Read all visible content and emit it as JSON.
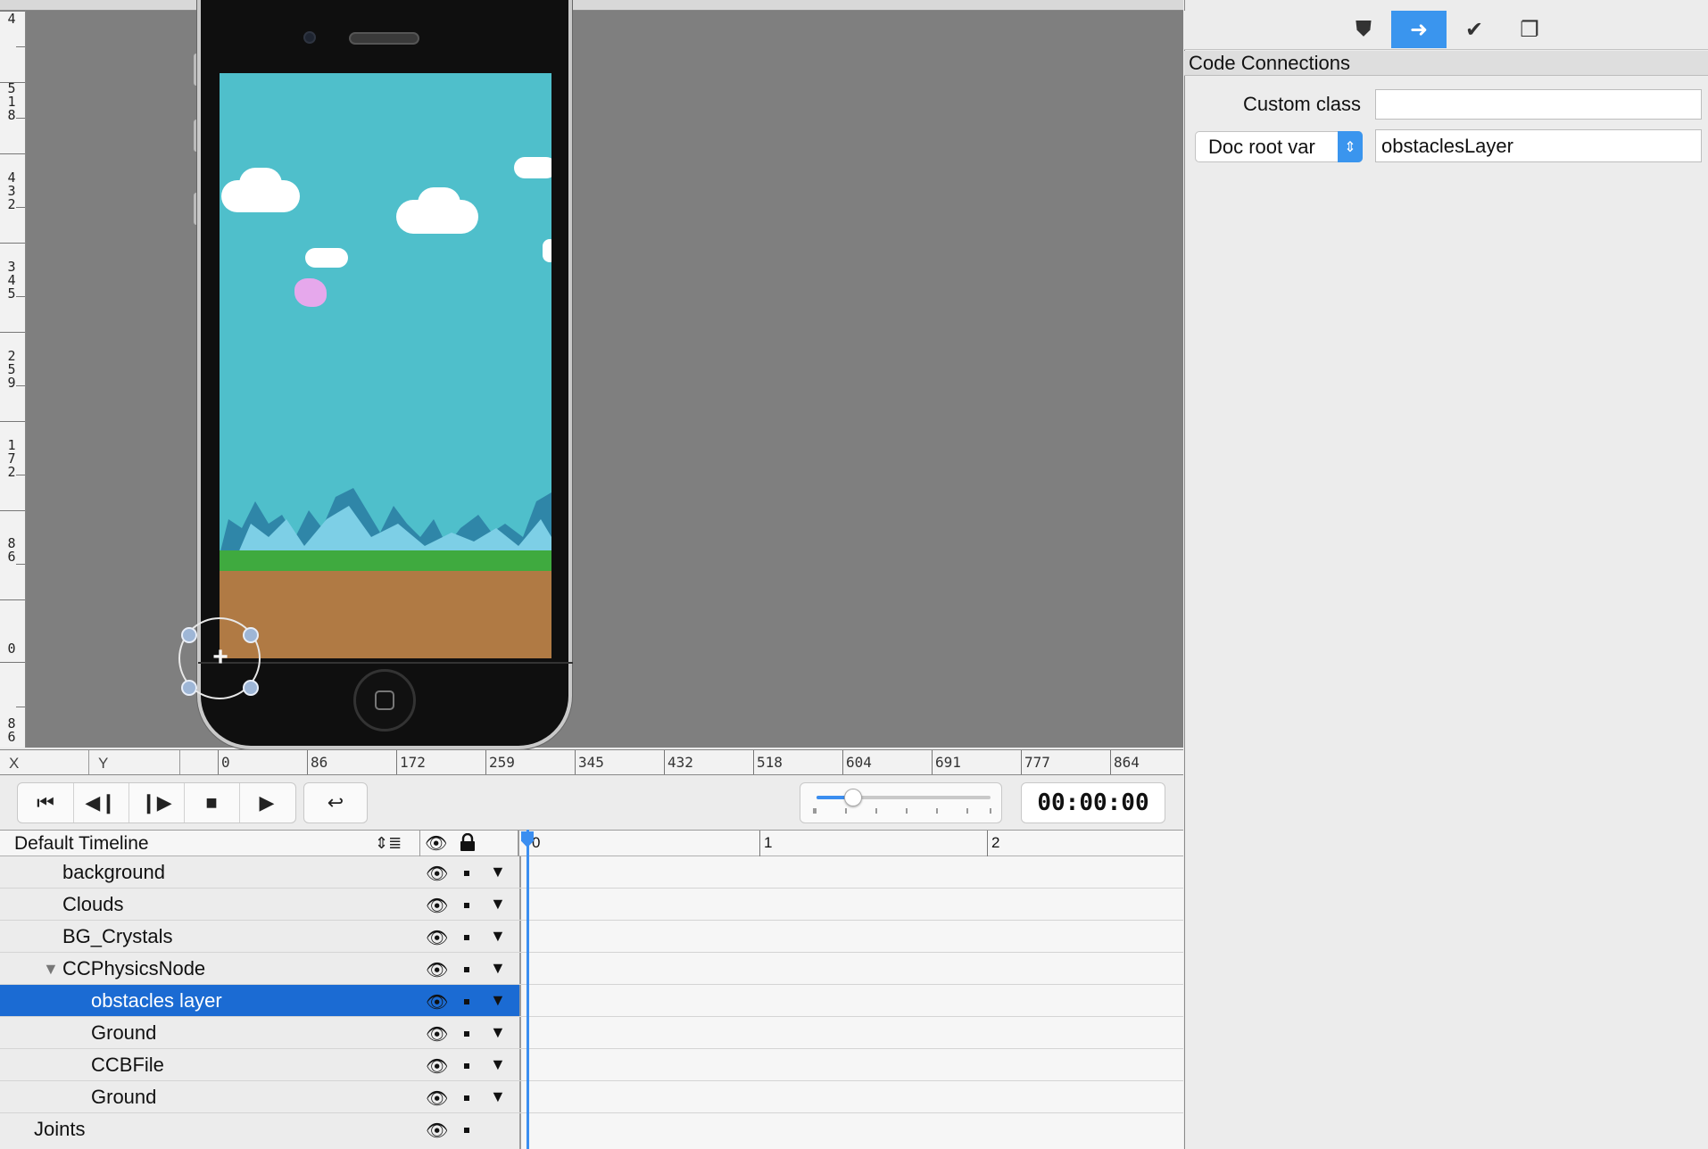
{
  "vruler": {
    "labels": [
      "4",
      "518",
      "432",
      "345",
      "259",
      "172",
      "86",
      "0",
      "86"
    ]
  },
  "xy": {
    "x_label": "X",
    "y_label": "Y"
  },
  "hruler": {
    "labels": [
      "0",
      "86",
      "172",
      "259",
      "345",
      "432",
      "518",
      "604",
      "691",
      "777",
      "864"
    ]
  },
  "transport": {
    "buttons": [
      "skip-to-start",
      "step-back",
      "step-forward",
      "stop",
      "play",
      "loop"
    ],
    "time": "00:00:00",
    "zoom_level": 0.2
  },
  "timeline": {
    "name": "Default Timeline",
    "time_ticks": [
      "0",
      "1",
      "2"
    ],
    "rows": [
      {
        "label": "background"
      },
      {
        "label": "Clouds"
      },
      {
        "label": "BG_Crystals"
      },
      {
        "label": "CCPhysicsNode"
      },
      {
        "label": "obstacles layer"
      },
      {
        "label": "Ground"
      },
      {
        "label": "CCBFile"
      },
      {
        "label": "Ground"
      },
      {
        "label": "Joints"
      }
    ]
  },
  "panel": {
    "tabs": [
      "shield-icon",
      "arrow-circle-icon",
      "check-hammer-icon",
      "stack-icon"
    ],
    "section_title": "Code Connections",
    "custom_class_label": "Custom class",
    "custom_class_value": "",
    "doc_root_select": "Doc root var",
    "doc_root_value": "obstaclesLayer"
  },
  "colors": {
    "accent": "#3a95ee",
    "selection": "#1b6bd3",
    "sky": "#4fbfcb",
    "canvas": "#7f7f7f"
  }
}
